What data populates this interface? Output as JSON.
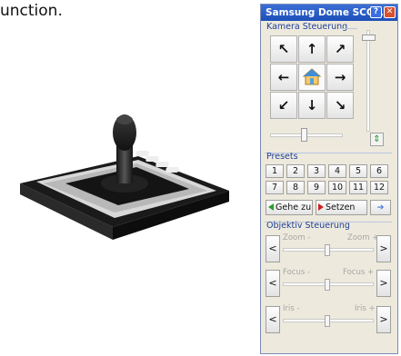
{
  "intro_text": "unction.",
  "window": {
    "title": "Samsung Dome SCC6...",
    "help_label": "?",
    "close_label": "✕"
  },
  "camera": {
    "group_label": "Kamera Steuerung",
    "arrows": {
      "up_left": "↖",
      "up": "↑",
      "up_right": "↗",
      "left": "←",
      "right": "→",
      "down_left": "↙",
      "down": "↓",
      "down_right": "↘"
    }
  },
  "presets": {
    "group_label": "Presets",
    "numbers": [
      "1",
      "2",
      "3",
      "4",
      "5",
      "6",
      "7",
      "8",
      "9",
      "10",
      "11",
      "12"
    ],
    "goto_label": "Gehe zu",
    "set_label": "Setzen"
  },
  "lens": {
    "group_label": "Objektiv Steuerung",
    "minus_label": "<",
    "plus_label": ">",
    "zoom_minus": "Zoom -",
    "zoom_plus": "Zoom +",
    "focus_minus": "Focus -",
    "focus_plus": "Focus +",
    "iris_minus": "Iris -",
    "iris_plus": "Iris +"
  },
  "colors": {
    "titlebar": "#1d4fb8",
    "group_label": "#1f3f9a",
    "goto_arrow": "#2f9e2f",
    "set_arrow": "#cf2020"
  }
}
